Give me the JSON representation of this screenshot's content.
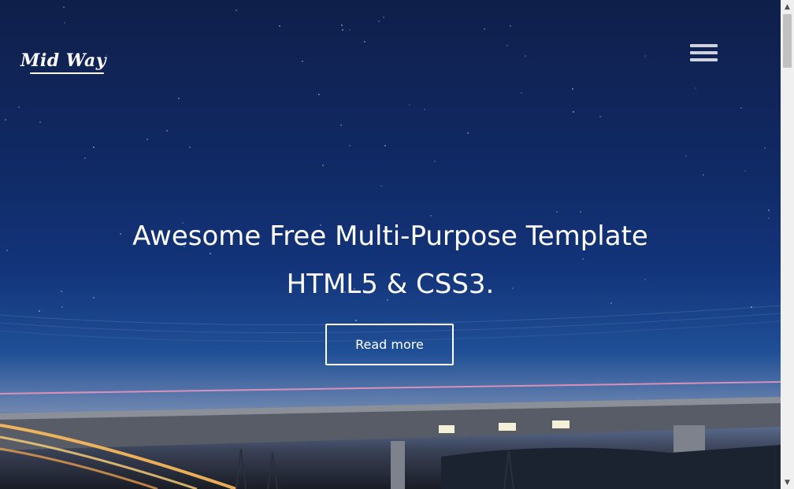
{
  "header": {
    "logo_text": "Mid Way",
    "menu_icon": "hamburger-icon"
  },
  "hero": {
    "headline_line1": "Awesome Free Multi-Purpose Template",
    "headline_line2": "HTML5 & CSS3.",
    "cta_label": "Read more"
  },
  "scrollbar": {
    "up_icon": "▲",
    "down_icon": "▼"
  },
  "colors": {
    "sky_top": "#0f1f4a",
    "sky_mid": "#13347a",
    "horizon": "#6e86b0",
    "text": "#ffffff"
  }
}
